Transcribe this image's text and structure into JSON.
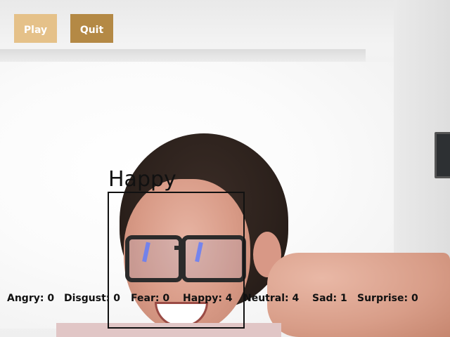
{
  "controls": {
    "play_label": "Play",
    "quit_label": "Quit"
  },
  "detection": {
    "label": "Happy"
  },
  "emotion_counts": [
    {
      "label": "Angry: 0"
    },
    {
      "label": "Disgust: 0"
    },
    {
      "label": "Fear: 0"
    },
    {
      "label": "Happy: 4"
    },
    {
      "label": "Neutral: 4"
    },
    {
      "label": "Sad: 1"
    },
    {
      "label": "Surprise: 0"
    }
  ],
  "colors": {
    "play_button": "#e5c189",
    "quit_button": "#b48945",
    "box": "#111111"
  }
}
